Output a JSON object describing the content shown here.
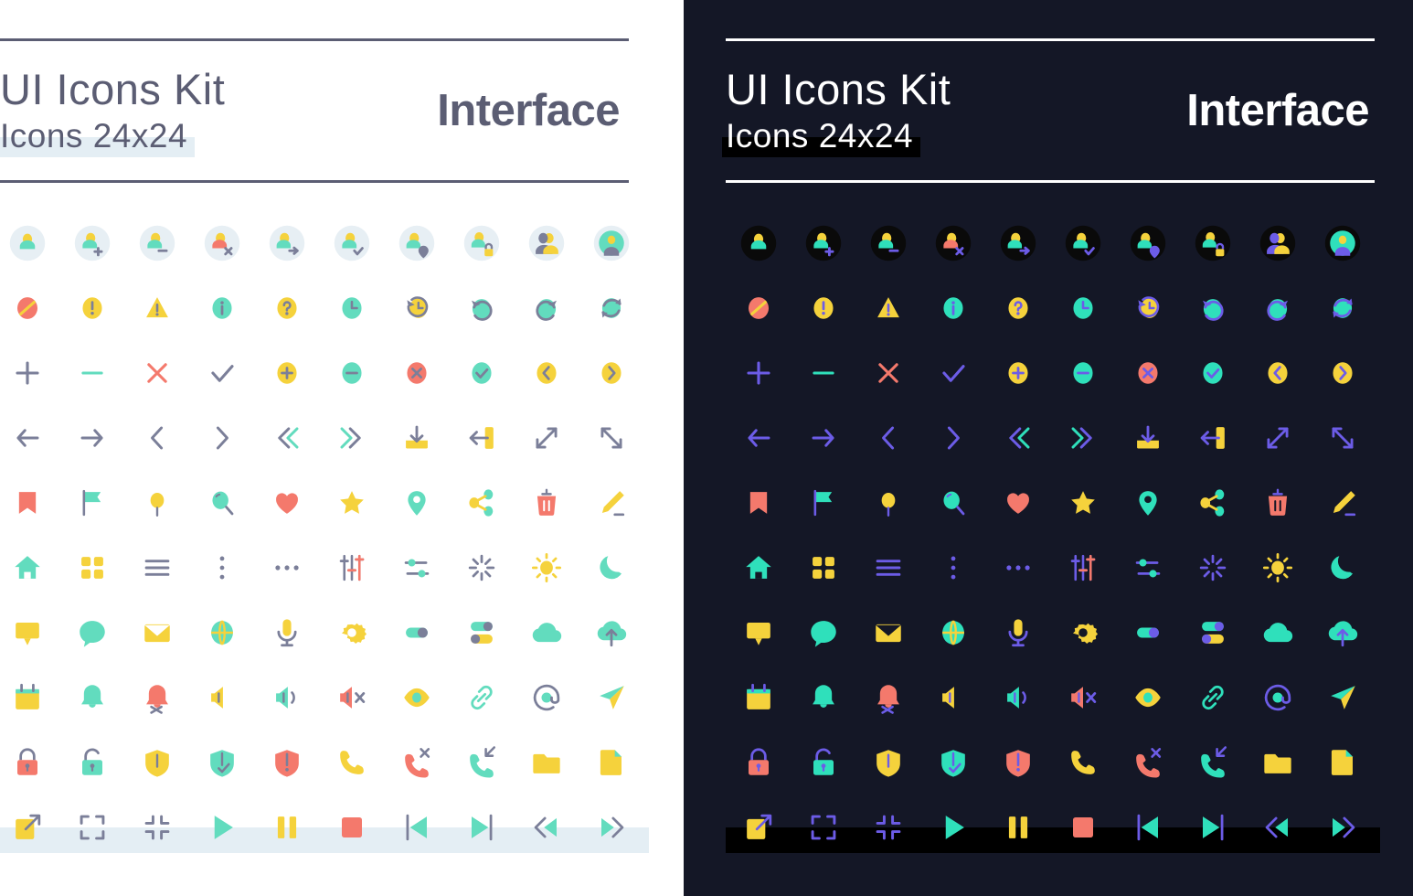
{
  "meta": {
    "sheet_title": "UI Icons Kit",
    "icon_size_label": "Icons 24x24",
    "category": "Interface",
    "grid_columns": 10,
    "grid_rows": 10,
    "total_icons": 100
  },
  "panels": [
    {
      "id": "light",
      "theme_label": "light",
      "background": "#ffffff",
      "title": "UI Icons Kit",
      "subtitle": "Icons 24x24",
      "category": "Interface",
      "rule_color": "#5b5d73",
      "text_color": "#5b5d73",
      "highlight_color": "#e4eef4",
      "avatar_bg": "#e7eff4",
      "palette": {
        "yellow": "#f5d23c",
        "teal": "#62dcbe",
        "coral": "#f4796c",
        "neutral": "#7b7f99",
        "accent_bg": "#e4eef4"
      }
    },
    {
      "id": "dark",
      "theme_label": "dark",
      "background": "#141726",
      "title": "UI Icons Kit",
      "subtitle": "Icons 24x24",
      "category": "Interface",
      "rule_color": "#ffffff",
      "text_color": "#ffffff",
      "highlight_color": "#000000",
      "avatar_bg": "#0a0a0a",
      "palette": {
        "yellow": "#f5d23c",
        "teal": "#2fe0bb",
        "coral": "#f4796c",
        "neutral": "#6c5ce7",
        "accent_bg": "#000000"
      }
    }
  ],
  "rows": [
    {
      "name": "users",
      "icons": [
        {
          "name": "user-icon",
          "label": "User"
        },
        {
          "name": "user-add-icon",
          "label": "Add user"
        },
        {
          "name": "user-remove-icon",
          "label": "Remove user"
        },
        {
          "name": "user-delete-icon",
          "label": "Delete user"
        },
        {
          "name": "user-transfer-icon",
          "label": "Transfer user"
        },
        {
          "name": "user-check-icon",
          "label": "Verified user"
        },
        {
          "name": "user-location-icon",
          "label": "User location"
        },
        {
          "name": "user-lock-icon",
          "label": "Locked user"
        },
        {
          "name": "user-group-icon",
          "label": "User group"
        },
        {
          "name": "user-profile-icon",
          "label": "User profile"
        }
      ]
    },
    {
      "name": "status",
      "icons": [
        {
          "name": "block-icon",
          "label": "Blocked"
        },
        {
          "name": "error-circle-icon",
          "label": "Error"
        },
        {
          "name": "warning-triangle-icon",
          "label": "Warning"
        },
        {
          "name": "info-circle-icon",
          "label": "Information"
        },
        {
          "name": "help-circle-icon",
          "label": "Help"
        },
        {
          "name": "clock-icon",
          "label": "Clock"
        },
        {
          "name": "history-icon",
          "label": "History"
        },
        {
          "name": "undo-icon",
          "label": "Undo"
        },
        {
          "name": "redo-icon",
          "label": "Redo"
        },
        {
          "name": "sync-icon",
          "label": "Sync"
        }
      ]
    },
    {
      "name": "actions",
      "icons": [
        {
          "name": "plus-icon",
          "label": "Add"
        },
        {
          "name": "minus-icon",
          "label": "Subtract"
        },
        {
          "name": "close-icon",
          "label": "Close"
        },
        {
          "name": "check-icon",
          "label": "Check"
        },
        {
          "name": "plus-circle-icon",
          "label": "Add circle"
        },
        {
          "name": "minus-circle-icon",
          "label": "Minus circle"
        },
        {
          "name": "close-circle-icon",
          "label": "Close circle"
        },
        {
          "name": "check-circle-icon",
          "label": "Check circle"
        },
        {
          "name": "chevron-left-circle-icon",
          "label": "Previous"
        },
        {
          "name": "chevron-right-circle-icon",
          "label": "Next"
        }
      ]
    },
    {
      "name": "navigation",
      "icons": [
        {
          "name": "arrow-left-icon",
          "label": "Back"
        },
        {
          "name": "arrow-right-icon",
          "label": "Forward"
        },
        {
          "name": "chevron-left-icon",
          "label": "Chevron left"
        },
        {
          "name": "chevron-right-icon",
          "label": "Chevron right"
        },
        {
          "name": "chevrons-left-icon",
          "label": "First"
        },
        {
          "name": "chevrons-right-icon",
          "label": "Last"
        },
        {
          "name": "download-icon",
          "label": "Download"
        },
        {
          "name": "logout-icon",
          "label": "Log out"
        },
        {
          "name": "expand-icon",
          "label": "Expand"
        },
        {
          "name": "resize-icon",
          "label": "Resize"
        }
      ]
    },
    {
      "name": "content",
      "icons": [
        {
          "name": "bookmark-icon",
          "label": "Bookmark"
        },
        {
          "name": "flag-icon",
          "label": "Flag"
        },
        {
          "name": "pin-icon",
          "label": "Pin"
        },
        {
          "name": "search-icon",
          "label": "Search"
        },
        {
          "name": "heart-icon",
          "label": "Favorite"
        },
        {
          "name": "star-icon",
          "label": "Star"
        },
        {
          "name": "map-pin-icon",
          "label": "Location"
        },
        {
          "name": "share-icon",
          "label": "Share"
        },
        {
          "name": "trash-icon",
          "label": "Delete"
        },
        {
          "name": "edit-icon",
          "label": "Edit"
        }
      ]
    },
    {
      "name": "layout",
      "icons": [
        {
          "name": "home-icon",
          "label": "Home"
        },
        {
          "name": "grid-icon",
          "label": "Grid"
        },
        {
          "name": "menu-icon",
          "label": "Menu"
        },
        {
          "name": "more-vertical-icon",
          "label": "More vertical"
        },
        {
          "name": "more-horizontal-icon",
          "label": "More horizontal"
        },
        {
          "name": "sliders-vertical-icon",
          "label": "Equalizer"
        },
        {
          "name": "sliders-horizontal-icon",
          "label": "Filters"
        },
        {
          "name": "loading-icon",
          "label": "Loading"
        },
        {
          "name": "sun-icon",
          "label": "Light mode"
        },
        {
          "name": "moon-icon",
          "label": "Dark mode"
        }
      ]
    },
    {
      "name": "communication",
      "icons": [
        {
          "name": "tooltip-icon",
          "label": "Tooltip"
        },
        {
          "name": "chat-icon",
          "label": "Chat"
        },
        {
          "name": "mail-icon",
          "label": "Mail"
        },
        {
          "name": "globe-icon",
          "label": "Globe"
        },
        {
          "name": "microphone-icon",
          "label": "Microphone"
        },
        {
          "name": "gear-icon",
          "label": "Settings"
        },
        {
          "name": "toggle-icon",
          "label": "Toggle"
        },
        {
          "name": "toggles-icon",
          "label": "Toggles"
        },
        {
          "name": "cloud-icon",
          "label": "Cloud"
        },
        {
          "name": "cloud-upload-icon",
          "label": "Cloud upload"
        }
      ]
    },
    {
      "name": "alerts",
      "icons": [
        {
          "name": "calendar-icon",
          "label": "Calendar"
        },
        {
          "name": "bell-icon",
          "label": "Notifications"
        },
        {
          "name": "bell-off-icon",
          "label": "Mute notifications"
        },
        {
          "name": "volume-mute-icon",
          "label": "Volume off"
        },
        {
          "name": "volume-icon",
          "label": "Volume"
        },
        {
          "name": "volume-x-icon",
          "label": "Volume muted"
        },
        {
          "name": "eye-icon",
          "label": "Visible"
        },
        {
          "name": "link-icon",
          "label": "Link"
        },
        {
          "name": "at-sign-icon",
          "label": "Mention"
        },
        {
          "name": "send-icon",
          "label": "Send"
        }
      ]
    },
    {
      "name": "security",
      "icons": [
        {
          "name": "lock-icon",
          "label": "Locked"
        },
        {
          "name": "unlock-icon",
          "label": "Unlocked"
        },
        {
          "name": "shield-icon",
          "label": "Shield"
        },
        {
          "name": "shield-check-icon",
          "label": "Protected"
        },
        {
          "name": "shield-alert-icon",
          "label": "Shield alert"
        },
        {
          "name": "phone-icon",
          "label": "Call"
        },
        {
          "name": "phone-missed-icon",
          "label": "Missed call"
        },
        {
          "name": "phone-incoming-icon",
          "label": "Incoming call"
        },
        {
          "name": "folder-icon",
          "label": "Folder"
        },
        {
          "name": "file-icon",
          "label": "File"
        }
      ]
    },
    {
      "name": "media",
      "highlighted": true,
      "icons": [
        {
          "name": "external-link-icon",
          "label": "Open external"
        },
        {
          "name": "fullscreen-icon",
          "label": "Fullscreen"
        },
        {
          "name": "minimize-icon",
          "label": "Minimize"
        },
        {
          "name": "play-icon",
          "label": "Play"
        },
        {
          "name": "pause-icon",
          "label": "Pause"
        },
        {
          "name": "stop-icon",
          "label": "Stop"
        },
        {
          "name": "skip-back-icon",
          "label": "Skip back"
        },
        {
          "name": "skip-forward-icon",
          "label": "Skip forward"
        },
        {
          "name": "rewind-icon",
          "label": "Rewind"
        },
        {
          "name": "fast-forward-icon",
          "label": "Fast forward"
        }
      ]
    }
  ]
}
